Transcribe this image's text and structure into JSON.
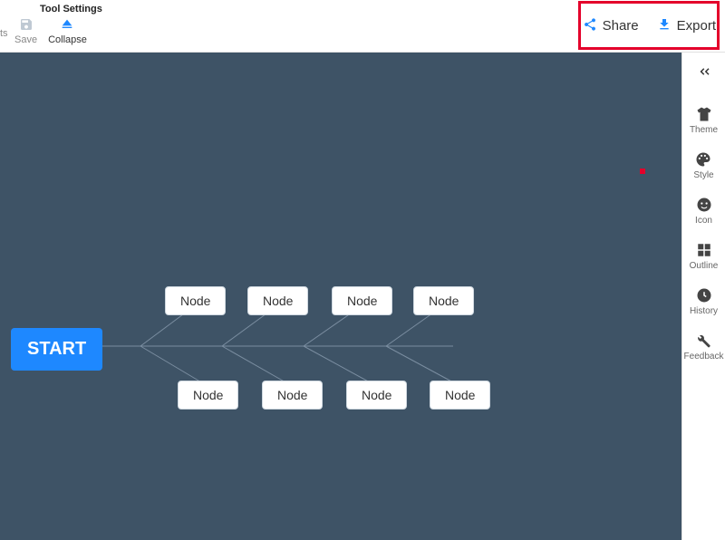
{
  "toolbar": {
    "partial_text": "ts",
    "title": "Tool Settings",
    "save": "Save",
    "collapse": "Collapse",
    "share": "Share",
    "export": "Export"
  },
  "side": {
    "theme": "Theme",
    "style": "Style",
    "icon": "Icon",
    "outline": "Outline",
    "history": "History",
    "feedback": "Feedback"
  },
  "canvas": {
    "start": "START",
    "nodes_top": [
      "Node",
      "Node",
      "Node",
      "Node"
    ],
    "nodes_bottom": [
      "Node",
      "Node",
      "Node",
      "Node"
    ]
  },
  "colors": {
    "accent": "#1e88ff",
    "canvas_bg": "#3e5366",
    "highlight": "#e4002b"
  }
}
